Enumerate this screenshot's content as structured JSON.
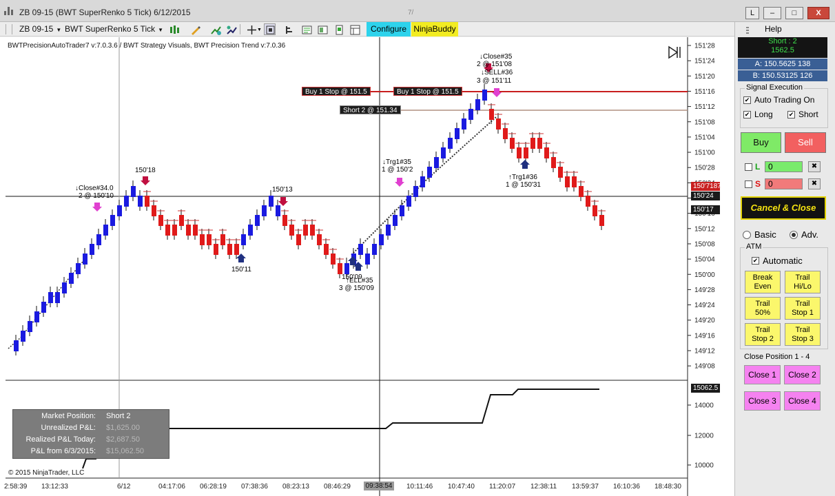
{
  "window": {
    "title": "ZB 09-15 (BWT SuperRenko  5 Tick) 6/12/2015",
    "controls": {
      "link": "L",
      "minimize": "–",
      "maximize": "□",
      "close": "X"
    },
    "center_mark": "7/"
  },
  "toolbar": {
    "instrument": "ZB 09-15",
    "bar_type": "BWT SuperRenko  5 Tick",
    "configure_label": "Configure",
    "ninjabuddy_label": "NinjaBuddy"
  },
  "chart": {
    "strategy_label": "BWTPrecisionAutoTrader7 v:7.0.3.6 / BWT Strategy Visuals, BWT Precision Trend v:7.0.36",
    "price_axis": [
      "151'28",
      "151'24",
      "151'20",
      "151'16",
      "151'12",
      "151'08",
      "151'04",
      "151'00",
      "150'28",
      "150'24",
      "150'20",
      "150'16",
      "150'12",
      "150'08",
      "150'04",
      "150'00",
      "149'28",
      "149'24",
      "149'20",
      "149'16",
      "149'12",
      "149'08"
    ],
    "equity_axis": [
      "14000",
      "12000",
      "10000"
    ],
    "time_axis": [
      "2:58:39",
      "13:12:33",
      "6/12",
      "04:17:06",
      "06:28:19",
      "07:38:36",
      "08:23:13",
      "08:46:29",
      "10:11:46",
      "10:47:40",
      "11:20:07",
      "12:38:11",
      "13:59:37",
      "16:10:36",
      "18:48:30"
    ],
    "time_highlight": "09:38:54",
    "price_tags": {
      "last": "150'71875",
      "crosshair": "150'24",
      "current": "150'17",
      "equity": "15062.5"
    },
    "orders": {
      "buy_stop_1": "Buy 1 Stop @ 151.5",
      "buy_stop_2": "Buy 1 Stop @ 151.5",
      "short_order": "Short 2 @ 151.34"
    },
    "annotations": {
      "hi_1": "150'18",
      "close_34_a": "↓Close#34.0",
      "close_34_b": "2 @ 150'10",
      "lo_1": "150'11",
      "hi_2": "150'13",
      "lo_2": "150'09",
      "sell_35_a": "↑ELL#35",
      "sell_35_b": "3 @ 150'09",
      "trg_35_a": "↓Trg1#35",
      "trg_35_b": "1 @ 150'2",
      "close_35_a": "↓Close#35",
      "close_35_b": "2 @ 151'08",
      "sell_36_a": "↓SELL#36",
      "sell_36_b": "3 @ 151'11",
      "trg_36_a": "↑Trg1#36",
      "trg_36_b": "1 @ 150'31"
    },
    "pnl": {
      "market_position_label": "Market Position:",
      "market_position_value": "Short 2",
      "unrealized_label": "Unrealized P&L:",
      "unrealized_value": "$1,625.00",
      "realized_label": "Realized P&L Today:",
      "realized_value": "$2,687.50",
      "total_label": "P&L from 6/3/2015:",
      "total_value": "$15,062.50"
    },
    "copyright": "© 2015 NinjaTrader, LLC",
    "colors": {
      "up_bar": "#1a1ae0",
      "down_bar": "#e01a1a",
      "buy_line": "#c81e1e",
      "short_line": "#b09080"
    }
  },
  "panel": {
    "help": "Help",
    "position": {
      "side": "Short : 2",
      "qty": "1562.5"
    },
    "ask": "A: 150.5625 138",
    "bid": "B: 150.53125 126",
    "signal": {
      "title": "Signal Execution",
      "auto_trading": "Auto Trading On",
      "long": "Long",
      "short": "Short"
    },
    "buy_label": "Buy",
    "sell_label": "Sell",
    "long_qty": {
      "label": "L",
      "value": "0"
    },
    "short_qty": {
      "label": "S",
      "value": "0"
    },
    "clear_glyph": "✖",
    "cancel_close_label": "Cancel & Close",
    "mode_basic": "Basic",
    "mode_adv": "Adv.",
    "atm": {
      "title": "ATM",
      "automatic": "Automatic",
      "break_even_1": "Break",
      "break_even_2": "Even",
      "trail_hilo_1": "Trail",
      "trail_hilo_2": "Hi/Lo",
      "trail_50_1": "Trail",
      "trail_50_2": "50%",
      "trail_stop1_1": "Trail",
      "trail_stop1_2": "Stop 1",
      "trail_stop2_1": "Trail",
      "trail_stop2_2": "Stop 2",
      "trail_stop3_1": "Trail",
      "trail_stop3_2": "Stop 3"
    },
    "close_position_title": "Close Position 1 - 4",
    "close_1": "Close 1",
    "close_2": "Close 2",
    "close_3": "Close 3",
    "close_4": "Close 4"
  }
}
